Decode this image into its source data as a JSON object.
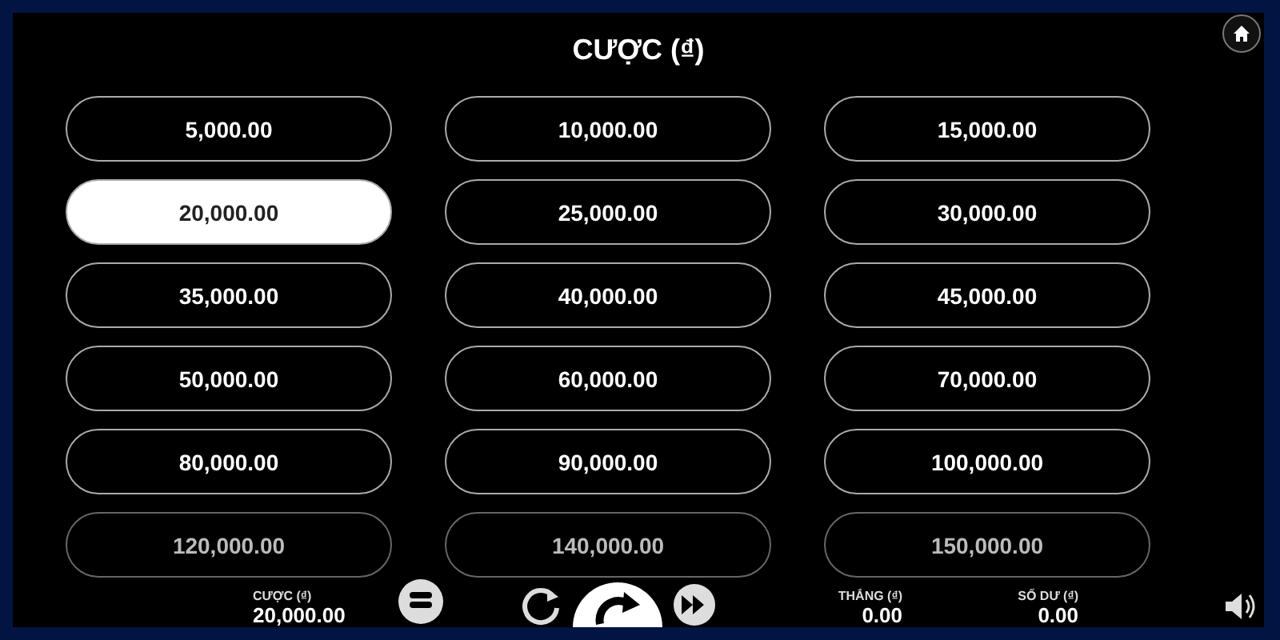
{
  "title": "CƯỢC (₫)",
  "bets": [
    {
      "value": "5,000.00",
      "selected": false
    },
    {
      "value": "10,000.00",
      "selected": false
    },
    {
      "value": "15,000.00",
      "selected": false
    },
    {
      "value": "20,000.00",
      "selected": true
    },
    {
      "value": "25,000.00",
      "selected": false
    },
    {
      "value": "30,000.00",
      "selected": false
    },
    {
      "value": "35,000.00",
      "selected": false
    },
    {
      "value": "40,000.00",
      "selected": false
    },
    {
      "value": "45,000.00",
      "selected": false
    },
    {
      "value": "50,000.00",
      "selected": false
    },
    {
      "value": "60,000.00",
      "selected": false
    },
    {
      "value": "70,000.00",
      "selected": false
    },
    {
      "value": "80,000.00",
      "selected": false
    },
    {
      "value": "90,000.00",
      "selected": false
    },
    {
      "value": "100,000.00",
      "selected": false
    },
    {
      "value": "120,000.00",
      "selected": false
    },
    {
      "value": "140,000.00",
      "selected": false
    },
    {
      "value": "150,000.00",
      "selected": false
    }
  ],
  "status": {
    "bet_label": "CƯỢC (₫)",
    "bet_value": "20,000.00",
    "win_label": "THẮNG (₫)",
    "win_value": "0.00",
    "balance_label": "SỐ DƯ (₫)",
    "balance_value": "0.00"
  }
}
